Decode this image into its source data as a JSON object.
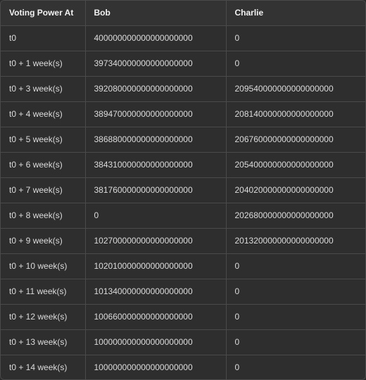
{
  "table": {
    "headers": [
      "Voting Power At",
      "Bob",
      "Charlie"
    ],
    "rows": [
      [
        "t0",
        "400000000000000000000",
        "0"
      ],
      [
        "t0 + 1 week(s)",
        "397340000000000000000",
        "0"
      ],
      [
        "t0 + 3 week(s)",
        "392080000000000000000",
        "209540000000000000000"
      ],
      [
        "t0 + 4 week(s)",
        "389470000000000000000",
        "208140000000000000000"
      ],
      [
        "t0 + 5 week(s)",
        "386880000000000000000",
        "206760000000000000000"
      ],
      [
        "t0 + 6 week(s)",
        "384310000000000000000",
        "205400000000000000000"
      ],
      [
        "t0 + 7 week(s)",
        "381760000000000000000",
        "204020000000000000000"
      ],
      [
        "t0 + 8 week(s)",
        "0",
        "202680000000000000000"
      ],
      [
        "t0 + 9 week(s)",
        "102700000000000000000",
        "201320000000000000000"
      ],
      [
        "t0 + 10 week(s)",
        "102010000000000000000",
        "0"
      ],
      [
        "t0 + 11 week(s)",
        "101340000000000000000",
        "0"
      ],
      [
        "t0 + 12 week(s)",
        "100660000000000000000",
        "0"
      ],
      [
        "t0 + 13 week(s)",
        "100000000000000000000",
        "0"
      ],
      [
        "t0 + 14 week(s)",
        "100000000000000000000",
        "0"
      ]
    ]
  }
}
